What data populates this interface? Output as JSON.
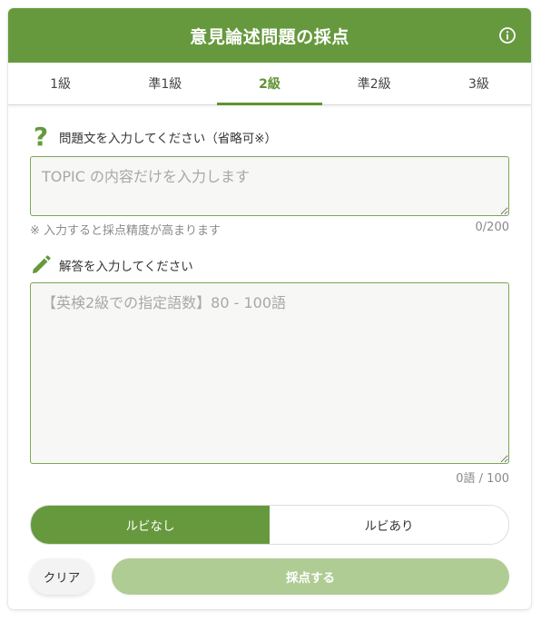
{
  "header": {
    "title": "意見論述問題の採点",
    "info_icon": "info-icon"
  },
  "tabs": [
    {
      "label": "1級",
      "active": false
    },
    {
      "label": "準1級",
      "active": false
    },
    {
      "label": "2級",
      "active": true
    },
    {
      "label": "準2級",
      "active": false
    },
    {
      "label": "3級",
      "active": false
    }
  ],
  "topic": {
    "icon": "question-mark-icon",
    "label": "問題文を入力してください（省略可※）",
    "placeholder": "TOPIC の内容だけを入力します",
    "value": "",
    "note": "※ 入力すると採点精度が高まります",
    "counter": "0/200"
  },
  "answer": {
    "icon": "pencil-icon",
    "label": "解答を入力してください",
    "placeholder": "【英検2級での指定語数】80 - 100語",
    "value": "",
    "counter": "0語 / 100"
  },
  "ruby_toggle": {
    "off_label": "ルビなし",
    "on_label": "ルビあり",
    "selected": "ルビなし"
  },
  "actions": {
    "clear_label": "クリア",
    "submit_label": "採点する"
  },
  "colors": {
    "brand_green": "#66993d",
    "tab_active": "#5f9332",
    "submit_disabled": "#b0cc95"
  }
}
